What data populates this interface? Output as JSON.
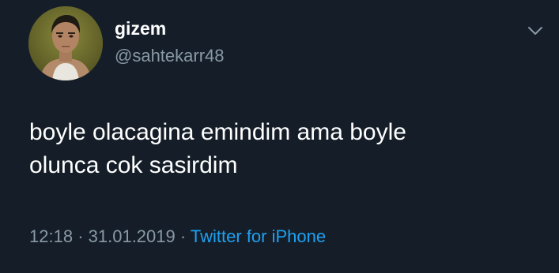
{
  "tweet": {
    "display_name": "gizem",
    "handle": "@sahtekarr48",
    "text_lines": [
      "boyle olacagina emindim ama boyle",
      "olunca cok sasirdim"
    ],
    "time": "12:18",
    "separator": "·",
    "date": "31.01.2019",
    "source": "Twitter for iPhone"
  },
  "icons": {
    "caret": "chevron-down-icon"
  },
  "colors": {
    "background": "#151e28",
    "primary_text": "#ffffff",
    "secondary_text": "#8899a6",
    "link": "#1da1f2"
  }
}
